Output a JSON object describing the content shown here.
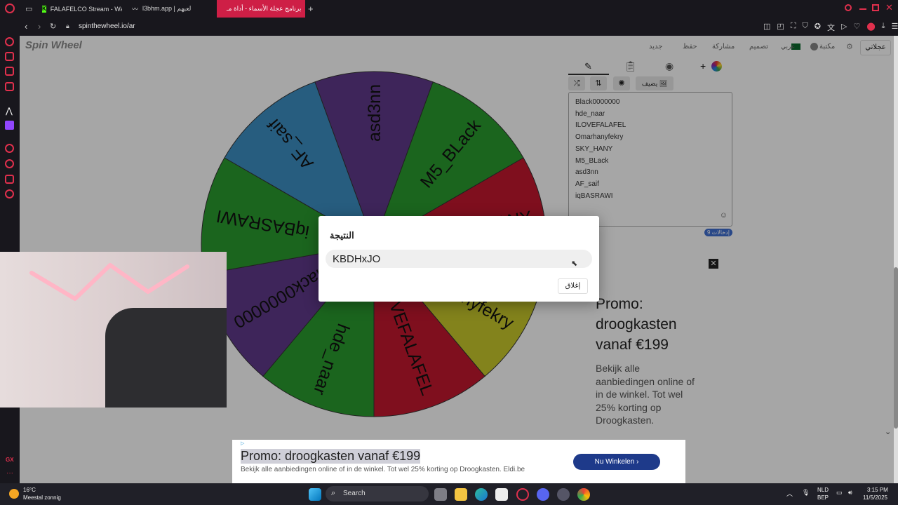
{
  "browser": {
    "tabs": [
      {
        "label": "FALAFELCO Stream - Wa"
      },
      {
        "label": "l3bhm.app | لعبهم"
      },
      {
        "label": "برنامج عجلة الأسماء - أداة مـ"
      }
    ],
    "url": "spinthewheel.io/ar",
    "new_tab": "+"
  },
  "site": {
    "logo": "Spin Wheel",
    "nav": {
      "my_wheel": "عجلاتي",
      "gallery": "مكتبة",
      "lang": "عربي",
      "design": "تصميم",
      "share": "مشاركة",
      "save": "حفظ",
      "new": "جديد"
    },
    "tools": {
      "add_image": "يضيف"
    },
    "entries": [
      "Black0000000",
      "hde_naar",
      "ILOVEFALAFEL",
      "Omarhanyfekry",
      "SKY_HANY",
      "M5_BLack",
      "asd3nn",
      "AF_saif",
      "iqBASRAWI"
    ],
    "entries_count": "إدخالات 9"
  },
  "wheel": {
    "segments": [
      {
        "label": "asd3nn",
        "color": "#60398a"
      },
      {
        "label": "M5_BLack",
        "color": "#2a9b2e"
      },
      {
        "label": "SKY_HANY",
        "color": "#c3182f"
      },
      {
        "label": "Omarhanyfekry",
        "color": "#c9c92c"
      },
      {
        "label": "ILOVEFALAFEL",
        "color": "#c3182f"
      },
      {
        "label": "hde_naar",
        "color": "#2a9b2e"
      },
      {
        "label": "Black0000000",
        "color": "#60398a"
      },
      {
        "label": "iqBASRAWI",
        "color": "#2a9b2e"
      },
      {
        "label": "AF_saif",
        "color": "#3d8fc4"
      }
    ]
  },
  "dialog": {
    "title": "النتيجة",
    "result": "KBDHxJO",
    "close": "إغلاق"
  },
  "ad_side": {
    "title": "Promo: droogkasten vanaf €199",
    "body": "Bekijk alle aanbiedingen online of in de winkel. Tot wel 25% korting op Droogkasten."
  },
  "ad_bottom": {
    "title": "Promo: droogkasten vanaf €199",
    "body": "Bekijk alle aanbiedingen online of in de winkel. Tot wel 25% korting op Droogkasten. Eldi.be",
    "cta": "Nu Winkelen"
  },
  "taskbar": {
    "temp": "16°C",
    "weather": "Meestal zonnig",
    "search": "Search",
    "lang1": "NLD",
    "lang2": "BEP",
    "time": "3:15 PM",
    "date": "11/5/2025"
  }
}
